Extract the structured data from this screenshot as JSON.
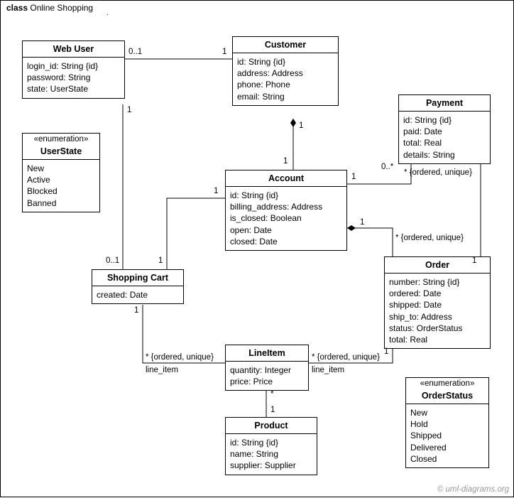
{
  "frame": {
    "kind": "class",
    "title": "Online Shopping"
  },
  "classes": {
    "webuser": {
      "name": "Web User",
      "attrs": [
        "login_id: String {id}",
        "password: String",
        "state: UserState"
      ]
    },
    "customer": {
      "name": "Customer",
      "attrs": [
        "id: String {id}",
        "address: Address",
        "phone: Phone",
        "email: String"
      ]
    },
    "payment": {
      "name": "Payment",
      "attrs": [
        "id: String {id}",
        "paid: Date",
        "total: Real",
        "details: String"
      ]
    },
    "userstate": {
      "stereo": "«enumeration»",
      "name": "UserState",
      "attrs": [
        "New",
        "Active",
        "Blocked",
        "Banned"
      ]
    },
    "account": {
      "name": "Account",
      "attrs": [
        "id: String {id}",
        "billing_address: Address",
        "is_closed: Boolean",
        "open: Date",
        "closed: Date"
      ]
    },
    "order": {
      "name": "Order",
      "attrs": [
        "number: String {id}",
        "ordered: Date",
        "shipped: Date",
        "ship_to: Address",
        "status: OrderStatus",
        "total: Real"
      ]
    },
    "shoppingcart": {
      "name": "Shopping Cart",
      "attrs": [
        "created: Date"
      ]
    },
    "lineitem": {
      "name": "LineItem",
      "attrs": [
        "quantity: Integer",
        "price: Price"
      ]
    },
    "orderstatus": {
      "stereo": "«enumeration»",
      "name": "OrderStatus",
      "attrs": [
        "New",
        "Hold",
        "Shipped",
        "Delivered",
        "Closed"
      ]
    },
    "product": {
      "name": "Product",
      "attrs": [
        "id: String {id}",
        "name: String",
        "supplier: Supplier"
      ]
    }
  },
  "labels": {
    "webuser_cust_left": "0..1",
    "webuser_cust_right": "1",
    "cust_acct_top": "1",
    "cust_acct_bot": "1",
    "webuser_cart_top": "1",
    "webuser_cart_bot": "0..1",
    "acct_cart_left": "1",
    "acct_cart_right": "1",
    "acct_pay_left": "1",
    "acct_pay_right": "0..*",
    "acct_order_a": "1",
    "acct_order_b": "* {ordered, unique}",
    "order_pay_a": "1",
    "order_pay_b": "* {ordered, unique}",
    "cart_li_a": "1",
    "cart_li_b": "* {ordered, unique}",
    "cart_li_role": "line_item",
    "order_li_a": "1",
    "order_li_b": "* {ordered, unique}",
    "order_li_role": "line_item",
    "li_prod_top": "*",
    "li_prod_bot": "1"
  },
  "credit": "© uml-diagrams.org"
}
